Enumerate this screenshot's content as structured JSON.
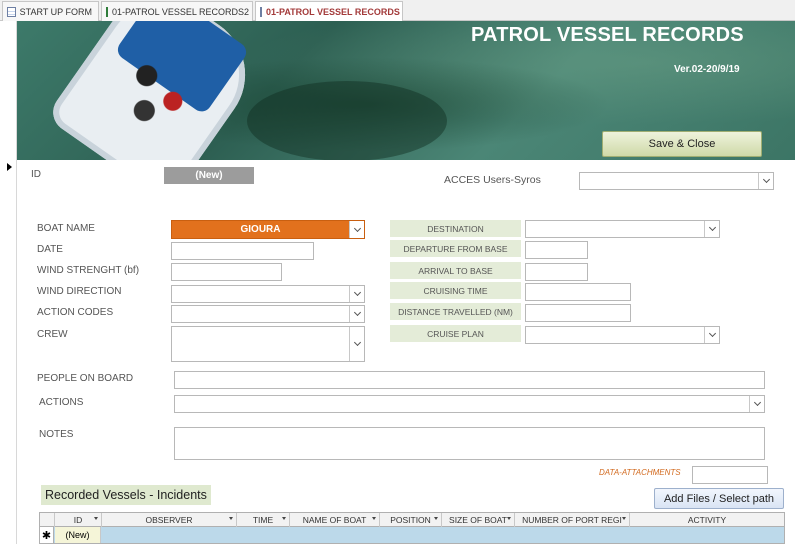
{
  "tabs": [
    {
      "label": "START UP FORM",
      "icon": "form-icon",
      "active": false
    },
    {
      "label": "01-PATROL VESSEL RECORDS2",
      "icon": "table-icon",
      "active": false
    },
    {
      "label": "01-PATROL VESSEL RECORDS",
      "icon": "form-icon",
      "active": true
    }
  ],
  "header": {
    "title": "PATROL VESSEL RECORDS",
    "version": "Ver.02-20/9/19",
    "save_close": "Save & Close"
  },
  "form": {
    "id_label": "ID",
    "id_value": "(New)",
    "acces_label": "ACCES Users-Syros",
    "acces_value": "",
    "boat_name_label": "BOAT NAME",
    "boat_name_value": "GIOURA",
    "date_label": "DATE",
    "date_value": "",
    "wind_strength_label": "WIND STRENGHT (bf)",
    "wind_strength_value": "",
    "wind_direction_label": "WIND DIRECTION",
    "wind_direction_value": "",
    "action_codes_label": "ACTION CODES",
    "action_codes_value": "",
    "crew_label": "CREW",
    "crew_value": "",
    "destination_label": "DESTINATION",
    "destination_value": "",
    "departure_label": "DEPARTURE FROM BASE",
    "departure_value": "",
    "arrival_label": "ARRIVAL TO BASE",
    "arrival_value": "",
    "cruising_time_label": "CRUISING TIME",
    "cruising_time_value": "",
    "distance_label": "DISTANCE TRAVELLED (NM)",
    "distance_value": "",
    "cruise_plan_label": "CRUISE PLAN",
    "cruise_plan_value": "",
    "people_label": "PEOPLE ON BOARD",
    "people_value": "",
    "actions_label": "ACTIONS",
    "actions_value": "",
    "notes_label": "NOTES",
    "notes_value": "",
    "attachments_label": "DATA-ATTACHMENTS",
    "attachments_value": "",
    "add_files": "Add Files / Select path"
  },
  "subform": {
    "title": "Recorded Vessels - Incidents",
    "columns": [
      "ID",
      "OBSERVER",
      "TIME",
      "NAME OF BOAT",
      "POSITION",
      "SIZE OF BOAT",
      "NUMBER OF PORT REGI",
      "ACTIVITY"
    ],
    "new_row_marker": "✱",
    "new_row_id": "(New)"
  }
}
